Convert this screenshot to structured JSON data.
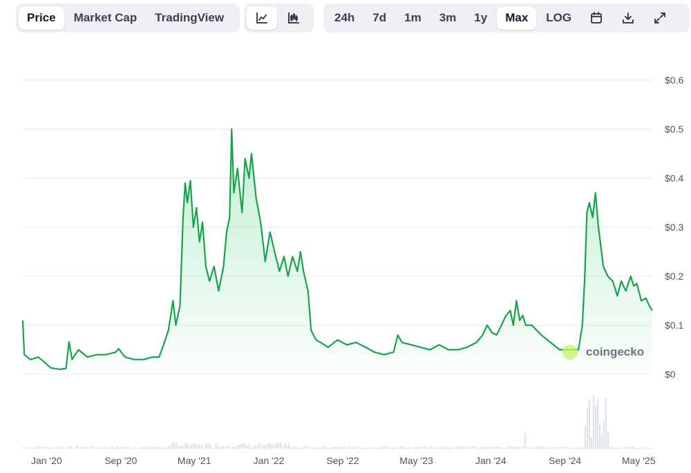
{
  "toolbar": {
    "chart_type_tabs": [
      {
        "label": "Price",
        "active": true
      },
      {
        "label": "Market Cap",
        "active": false
      },
      {
        "label": "TradingView",
        "active": false
      }
    ],
    "view_buttons": [
      {
        "icon": "line-chart-icon",
        "active": true
      },
      {
        "icon": "candlestick-chart-icon",
        "active": false
      }
    ],
    "range_buttons": [
      {
        "label": "24h",
        "active": false
      },
      {
        "label": "7d",
        "active": false
      },
      {
        "label": "1m",
        "active": false
      },
      {
        "label": "3m",
        "active": false
      },
      {
        "label": "1y",
        "active": false
      },
      {
        "label": "Max",
        "active": true
      },
      {
        "label": "LOG",
        "active": false
      }
    ],
    "tool_icons": [
      "calendar-icon",
      "download-icon",
      "expand-icon"
    ]
  },
  "watermark": "coingecko",
  "colors": {
    "line": "#16a34a",
    "fill": "#22c55e",
    "volume": "#cbd5e1",
    "grid": "#e5e7eb",
    "active_bg": "#ffffff",
    "toolbar_bg": "#eef0f3"
  },
  "chart_data": {
    "type": "area",
    "title": "",
    "xlabel": "",
    "ylabel": "",
    "y_ticks": [
      "$0",
      "$0.1",
      "$0.2",
      "$0.3",
      "$0.4",
      "$0.5",
      "$0.6"
    ],
    "ylim": [
      0,
      0.6
    ],
    "x_ticks": [
      {
        "label": "Jan '20",
        "date": "2020-01-01"
      },
      {
        "label": "Sep '20",
        "date": "2020-09-01"
      },
      {
        "label": "May '21",
        "date": "2021-05-01"
      },
      {
        "label": "Jan '22",
        "date": "2022-01-01"
      },
      {
        "label": "Sep '22",
        "date": "2022-09-01"
      },
      {
        "label": "May '23",
        "date": "2023-05-01"
      },
      {
        "label": "Jan '24",
        "date": "2024-01-01"
      },
      {
        "label": "Sep '24",
        "date": "2024-09-01"
      },
      {
        "label": "May '25",
        "date": "2025-05-01"
      }
    ],
    "xlim": [
      "2019-10-15",
      "2025-06-15"
    ],
    "grid": true,
    "series": [
      {
        "name": "",
        "points": [
          [
            "2019-10-15",
            0.11
          ],
          [
            "2019-10-20",
            0.04
          ],
          [
            "2019-11-10",
            0.03
          ],
          [
            "2019-12-05",
            0.035
          ],
          [
            "2019-12-25",
            0.025
          ],
          [
            "2020-01-15",
            0.013
          ],
          [
            "2020-02-15",
            0.01
          ],
          [
            "2020-03-05",
            0.012
          ],
          [
            "2020-03-15",
            0.066
          ],
          [
            "2020-03-25",
            0.03
          ],
          [
            "2020-04-15",
            0.05
          ],
          [
            "2020-05-15",
            0.035
          ],
          [
            "2020-06-15",
            0.04
          ],
          [
            "2020-07-15",
            0.04
          ],
          [
            "2020-08-15",
            0.045
          ],
          [
            "2020-08-25",
            0.052
          ],
          [
            "2020-09-15",
            0.035
          ],
          [
            "2020-10-15",
            0.03
          ],
          [
            "2020-11-15",
            0.03
          ],
          [
            "2020-12-15",
            0.035
          ],
          [
            "2021-01-05",
            0.035
          ],
          [
            "2021-01-20",
            0.06
          ],
          [
            "2021-02-05",
            0.09
          ],
          [
            "2021-02-20",
            0.15
          ],
          [
            "2021-03-01",
            0.1
          ],
          [
            "2021-03-15",
            0.14
          ],
          [
            "2021-03-25",
            0.32
          ],
          [
            "2021-04-01",
            0.39
          ],
          [
            "2021-04-08",
            0.35
          ],
          [
            "2021-04-18",
            0.395
          ],
          [
            "2021-04-28",
            0.3
          ],
          [
            "2021-05-08",
            0.34
          ],
          [
            "2021-05-18",
            0.27
          ],
          [
            "2021-05-28",
            0.31
          ],
          [
            "2021-06-08",
            0.22
          ],
          [
            "2021-06-20",
            0.19
          ],
          [
            "2021-07-05",
            0.22
          ],
          [
            "2021-07-20",
            0.17
          ],
          [
            "2021-08-05",
            0.22
          ],
          [
            "2021-08-15",
            0.29
          ],
          [
            "2021-08-25",
            0.32
          ],
          [
            "2021-09-01",
            0.5
          ],
          [
            "2021-09-08",
            0.37
          ],
          [
            "2021-09-20",
            0.42
          ],
          [
            "2021-10-05",
            0.33
          ],
          [
            "2021-10-15",
            0.44
          ],
          [
            "2021-10-28",
            0.4
          ],
          [
            "2021-11-05",
            0.45
          ],
          [
            "2021-11-20",
            0.36
          ],
          [
            "2021-12-05",
            0.31
          ],
          [
            "2021-12-20",
            0.23
          ],
          [
            "2022-01-05",
            0.29
          ],
          [
            "2022-01-20",
            0.25
          ],
          [
            "2022-02-05",
            0.21
          ],
          [
            "2022-02-20",
            0.24
          ],
          [
            "2022-03-05",
            0.2
          ],
          [
            "2022-03-20",
            0.24
          ],
          [
            "2022-04-05",
            0.21
          ],
          [
            "2022-04-15",
            0.25
          ],
          [
            "2022-04-25",
            0.21
          ],
          [
            "2022-05-10",
            0.17
          ],
          [
            "2022-05-20",
            0.09
          ],
          [
            "2022-06-05",
            0.07
          ],
          [
            "2022-06-20",
            0.065
          ],
          [
            "2022-07-15",
            0.055
          ],
          [
            "2022-08-15",
            0.07
          ],
          [
            "2022-09-15",
            0.06
          ],
          [
            "2022-10-15",
            0.065
          ],
          [
            "2022-11-15",
            0.055
          ],
          [
            "2022-12-15",
            0.045
          ],
          [
            "2023-01-15",
            0.04
          ],
          [
            "2023-02-15",
            0.045
          ],
          [
            "2023-03-01",
            0.08
          ],
          [
            "2023-03-15",
            0.065
          ],
          [
            "2023-04-15",
            0.06
          ],
          [
            "2023-05-15",
            0.055
          ],
          [
            "2023-06-15",
            0.05
          ],
          [
            "2023-07-15",
            0.06
          ],
          [
            "2023-08-15",
            0.05
          ],
          [
            "2023-09-15",
            0.05
          ],
          [
            "2023-10-15",
            0.055
          ],
          [
            "2023-11-15",
            0.065
          ],
          [
            "2023-12-05",
            0.08
          ],
          [
            "2023-12-20",
            0.1
          ],
          [
            "2024-01-05",
            0.085
          ],
          [
            "2024-01-20",
            0.08
          ],
          [
            "2024-02-05",
            0.1
          ],
          [
            "2024-02-20",
            0.12
          ],
          [
            "2024-03-05",
            0.13
          ],
          [
            "2024-03-15",
            0.1
          ],
          [
            "2024-03-25",
            0.15
          ],
          [
            "2024-04-05",
            0.11
          ],
          [
            "2024-04-15",
            0.12
          ],
          [
            "2024-04-25",
            0.1
          ],
          [
            "2024-05-15",
            0.1
          ],
          [
            "2024-06-15",
            0.08
          ],
          [
            "2024-07-15",
            0.065
          ],
          [
            "2024-08-15",
            0.05
          ],
          [
            "2024-09-15",
            0.05
          ],
          [
            "2024-10-15",
            0.05
          ],
          [
            "2024-10-28",
            0.1
          ],
          [
            "2024-11-05",
            0.2
          ],
          [
            "2024-11-12",
            0.33
          ],
          [
            "2024-11-20",
            0.35
          ],
          [
            "2024-12-01",
            0.32
          ],
          [
            "2024-12-10",
            0.37
          ],
          [
            "2024-12-20",
            0.3
          ],
          [
            "2025-01-05",
            0.22
          ],
          [
            "2025-01-20",
            0.2
          ],
          [
            "2025-02-05",
            0.19
          ],
          [
            "2025-02-20",
            0.16
          ],
          [
            "2025-03-05",
            0.19
          ],
          [
            "2025-03-20",
            0.17
          ],
          [
            "2025-04-05",
            0.2
          ],
          [
            "2025-04-15",
            0.18
          ],
          [
            "2025-04-25",
            0.185
          ],
          [
            "2025-05-10",
            0.15
          ],
          [
            "2025-05-25",
            0.155
          ],
          [
            "2025-06-05",
            0.14
          ],
          [
            "2025-06-15",
            0.13
          ]
        ]
      }
    ]
  }
}
